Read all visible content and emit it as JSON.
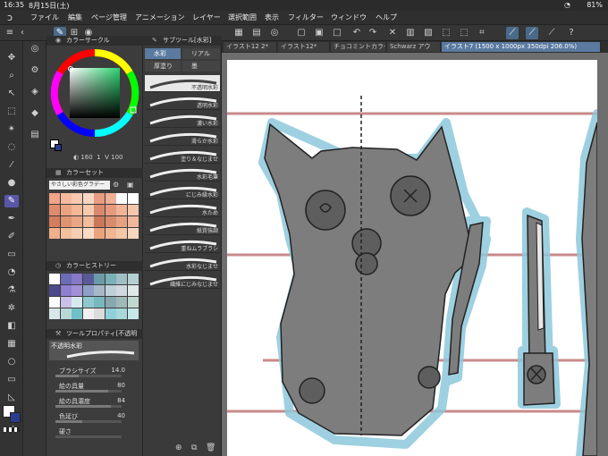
{
  "status": {
    "time": "16:35",
    "date": "8月15日(土)",
    "battery": "81%",
    "wifi": "◔"
  },
  "menu": [
    "ファイル",
    "編集",
    "ページ管理",
    "アニメーション",
    "レイヤー",
    "選択範囲",
    "表示",
    "フィルター",
    "ウィンドウ",
    "ヘルプ"
  ],
  "tabs": [
    {
      "label": "イラスト12 2*"
    },
    {
      "label": "イラスト12*"
    },
    {
      "label": "チョコミントカラー Schw"
    },
    {
      "label": "Schwarz アウ"
    },
    {
      "label": "イラスト7 (1500 x 1000px 350dpi 206.0%)"
    }
  ],
  "panels": {
    "color_circle": {
      "title": "カラーサークル",
      "h": "160",
      "s": "1",
      "v": "100"
    },
    "color_set": {
      "title": "カラーセット",
      "dropdown": "やさしい彩色グラデー"
    },
    "color_history": {
      "title": "カラーヒストリー"
    },
    "tool_property": {
      "title": "ツールプロパティ[不透明",
      "brush_name": "不透明水彩",
      "rows": [
        {
          "label": "ブラシサイズ",
          "value": "14.0",
          "fill": 0.35
        },
        {
          "label": "絵の具量",
          "value": "80",
          "fill": 0.8
        },
        {
          "label": "絵の具濃度",
          "value": "84",
          "fill": 0.84
        },
        {
          "label": "色延び",
          "value": "40",
          "fill": 0.4
        },
        {
          "label": "硬さ",
          "value": "",
          "fill": 0.0
        }
      ]
    }
  },
  "subtool": {
    "title": "サブツール[水彩]",
    "tabs": [
      "水彩",
      "リアル",
      "厚塗り",
      "墨"
    ],
    "brushes": [
      "不透明水彩",
      "透明水彩",
      "濃い水彩",
      "滑らか水彩",
      "塗り＆なじませ",
      "水彩毛筆",
      "にじみ縁水彩",
      "水ため",
      "紙質強調",
      "重ねムラブラシ",
      "水彩なじませ",
      "繊維にじみなじませ"
    ],
    "selected_index": 0
  },
  "colors": {
    "accent": "#5a7aa0",
    "canvas_bg": "#ffffff",
    "selection_purple": "#5a56a8"
  },
  "color_set_grid": [
    [
      "#f2a488",
      "#f6b99e",
      "#f8c9b0",
      "#f9d6c2",
      "#e79b80",
      "#f0b095",
      "#ffffff",
      "#ffffff"
    ],
    [
      "#e08c6c",
      "#eca282",
      "#f3b797",
      "#f7caae",
      "#d9896d",
      "#e69a7c",
      "#f1b496",
      "#f6c6ac"
    ],
    [
      "#d47d5d",
      "#e09372",
      "#eaa788",
      "#f1bc9f",
      "#c97859",
      "#d98c6d",
      "#e7a284",
      "#f0b79b"
    ],
    [
      "#f0b08a",
      "#f3c09e",
      "#f6cfb3",
      "#f8dcc6",
      "#e9a47f",
      "#efb693",
      "#f4c7a8",
      "#f7d6bd"
    ]
  ],
  "history_grid": [
    [
      "#ffffff",
      "#6b6bb8",
      "#8878c8",
      "#5a5a9a",
      "#6b9aa8",
      "#7ab0b8",
      "#9fc0c4",
      "#b5d0d0"
    ],
    [
      "#4a4a8a",
      "#8f7fd0",
      "#a290d8",
      "#8fa0c8",
      "#a8b8c8",
      "#c0d0d8",
      "#d0d8e0",
      "#e0e8e8"
    ],
    [
      "#ffffff",
      "#c8c0e8",
      "#d8e8f0",
      "#90c8d0",
      "#78b8c0",
      "#88a8b0",
      "#a0b8b8",
      "#c0d8d0"
    ],
    [
      "#d8e8e8",
      "#b8d8d8",
      "#70c0c8",
      "#f0f0f0",
      "#dcdcdc",
      "#90d0d8",
      "#a8d8d8",
      "#c8e8e8"
    ]
  ]
}
